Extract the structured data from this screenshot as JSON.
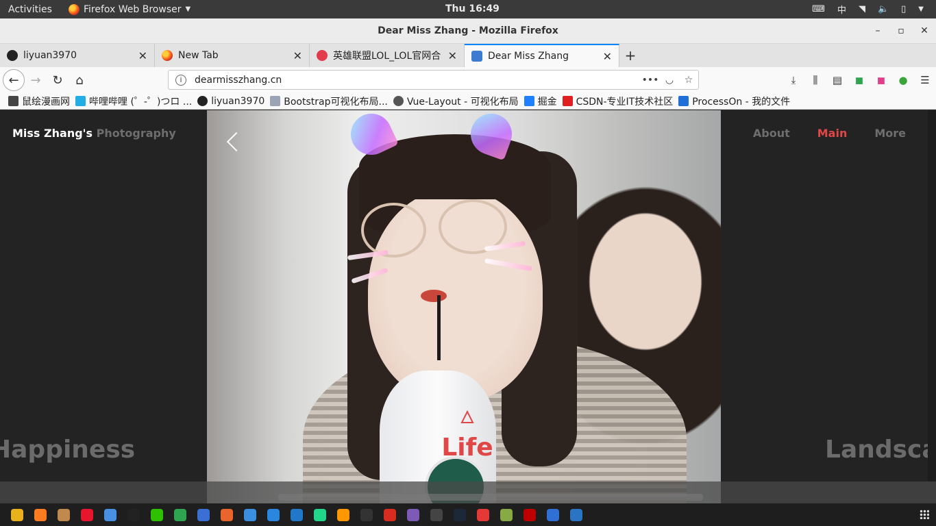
{
  "topbar": {
    "activities": "Activities",
    "app_name": "Firefox Web Browser",
    "clock": "Thu 16:49",
    "input_method": "中"
  },
  "window": {
    "title": "Dear Miss Zhang - Mozilla Firefox"
  },
  "tabs": [
    {
      "label": "liyuan3970",
      "icon": "github-icon",
      "color": "#222222"
    },
    {
      "label": "New Tab",
      "icon": "firefox-icon",
      "color": "#ff7b20"
    },
    {
      "label": "英雄联盟LOL_LOL官网合",
      "icon": "lol-icon",
      "color": "#e23b4b"
    },
    {
      "label": "Dear Miss Zhang",
      "icon": "site-icon",
      "color": "#3b7bd0",
      "active": true
    }
  ],
  "urlbar": {
    "url": "dearmisszhang.cn"
  },
  "bookmarks": [
    {
      "label": "鼠绘漫画网",
      "icon": "shuhui-icon",
      "color": "#444444"
    },
    {
      "label": "哔哩哔哩 (゜-゜)つロ ...",
      "icon": "bilibili-icon",
      "color": "#23ade5"
    },
    {
      "label": "liyuan3970",
      "icon": "github-icon",
      "color": "#222222"
    },
    {
      "label": "Bootstrap可视化布局...",
      "icon": "grid-icon",
      "color": "#9aa4b5"
    },
    {
      "label": "Vue-Layout - 可视化布局",
      "icon": "globe-icon",
      "color": "#555555"
    },
    {
      "label": "掘金",
      "icon": "juejin-icon",
      "color": "#1e80ff"
    },
    {
      "label": "CSDN-专业IT技术社区",
      "icon": "csdn-icon",
      "color": "#e02020"
    },
    {
      "label": "ProcessOn - 我的文件",
      "icon": "processon-icon",
      "color": "#1f6fd6"
    }
  ],
  "site": {
    "brand": "Miss Zhang's",
    "brand_sub": "Photography",
    "nav": [
      {
        "label": "About",
        "current": false
      },
      {
        "label": "Main",
        "current": true
      },
      {
        "label": "More",
        "current": false
      }
    ],
    "slide_left_label": "Happiness",
    "slide_center_label": "Life",
    "slide_right_label": "Landscape",
    "accent_color": "#e04848"
  },
  "dock": [
    {
      "icon": "chrome-icon",
      "color": "#e8b21c"
    },
    {
      "icon": "firefox-icon",
      "color": "#ff7b20"
    },
    {
      "icon": "files-icon",
      "color": "#c08a4e"
    },
    {
      "icon": "weibo-icon",
      "color": "#e6162d"
    },
    {
      "icon": "cloud-icon",
      "color": "#4a90e2"
    },
    {
      "icon": "qq-icon",
      "color": "#222222"
    },
    {
      "icon": "wechat-icon",
      "color": "#2dc100"
    },
    {
      "icon": "wps-sheet-icon",
      "color": "#2ea44f"
    },
    {
      "icon": "wps-writer-icon",
      "color": "#3b6fd6"
    },
    {
      "icon": "wps-presentation-icon",
      "color": "#e8662c"
    },
    {
      "icon": "network-icon",
      "color": "#3c8ede"
    },
    {
      "icon": "mail-icon",
      "color": "#2b86e0"
    },
    {
      "icon": "vscode-icon",
      "color": "#1f78c8"
    },
    {
      "icon": "pycharm-icon",
      "color": "#21d789"
    },
    {
      "icon": "sublime-icon",
      "color": "#ff9800"
    },
    {
      "icon": "terminal-icon",
      "color": "#333333"
    },
    {
      "icon": "redis-icon",
      "color": "#d82c20"
    },
    {
      "icon": "emacs-icon",
      "color": "#7d5ab5"
    },
    {
      "icon": "console-icon",
      "color": "#444444"
    },
    {
      "icon": "steam-icon",
      "color": "#1b2838"
    },
    {
      "icon": "stop-icon",
      "color": "#e53935"
    },
    {
      "icon": "inkscape-icon",
      "color": "#88aa44"
    },
    {
      "icon": "filezilla-icon",
      "color": "#bf0000"
    },
    {
      "icon": "tasks-icon",
      "color": "#2f6fd6"
    },
    {
      "icon": "vpn-icon",
      "color": "#2a73c5"
    }
  ]
}
